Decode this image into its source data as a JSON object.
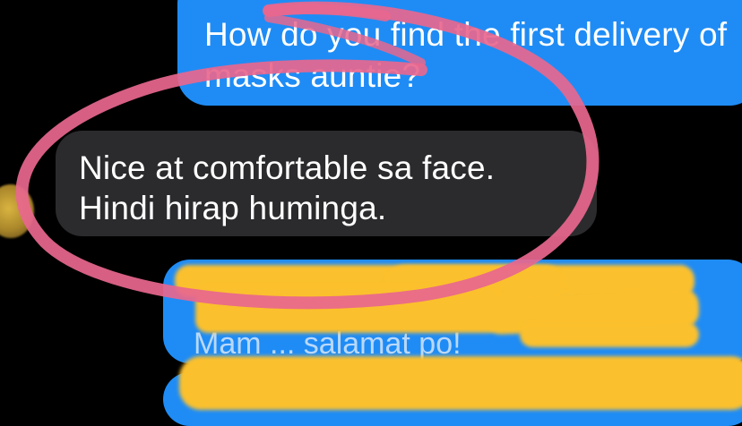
{
  "conversation": {
    "messages": [
      {
        "direction": "outgoing",
        "text": "How do you find the first delivery of masks auntie?"
      },
      {
        "direction": "incoming",
        "text": "Nice at comfortable sa face. Hindi hirap huminga."
      },
      {
        "direction": "outgoing",
        "text": "Mam ... salamat po!"
      },
      {
        "direction": "outgoing",
        "text": ""
      }
    ]
  },
  "annotations": {
    "highlight_color": "#e8678e",
    "redaction_color": "#fbc02d"
  },
  "colors": {
    "background": "#000000",
    "outgoing_bubble": "#1f8cf5",
    "incoming_bubble": "#2b2b2d",
    "text": "#ffffff"
  },
  "icons": {
    "avatar": "contact-avatar-icon"
  }
}
